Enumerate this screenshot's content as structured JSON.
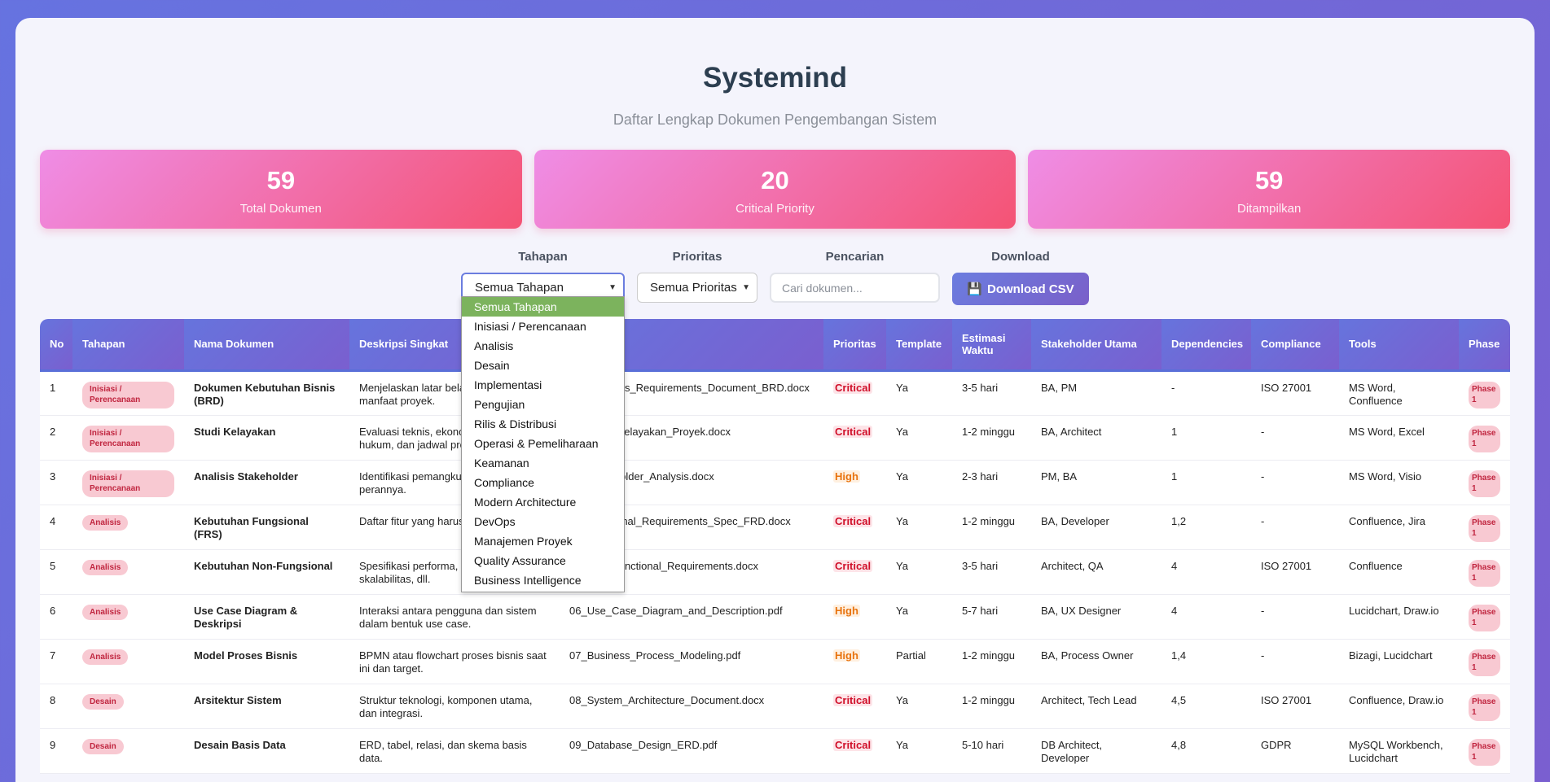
{
  "header": {
    "title": "Systemind",
    "subtitle": "Daftar Lengkap Dokumen Pengembangan Sistem"
  },
  "stats": [
    {
      "value": "59",
      "label": "Total Dokumen"
    },
    {
      "value": "20",
      "label": "Critical Priority"
    },
    {
      "value": "59",
      "label": "Ditampilkan"
    }
  ],
  "filters": {
    "stage_label": "Tahapan",
    "stage_value": "Semua Tahapan",
    "priority_label": "Prioritas",
    "priority_value": "Semua Prioritas",
    "search_label": "Pencarian",
    "search_placeholder": "Cari dokumen...",
    "download_label": "Download",
    "download_button": "Download CSV",
    "download_icon": "💾"
  },
  "stage_options": [
    "Semua Tahapan",
    "Inisiasi / Perencanaan",
    "Analisis",
    "Desain",
    "Implementasi",
    "Pengujian",
    "Rilis & Distribusi",
    "Operasi & Pemeliharaan",
    "Keamanan",
    "Compliance",
    "Modern Architecture",
    "DevOps",
    "Manajemen Proyek",
    "Quality Assurance",
    "Business Intelligence"
  ],
  "table": {
    "columns": [
      "No",
      "Tahapan",
      "Nama Dokumen",
      "Deskripsi Singkat",
      "Nama File",
      "Prioritas",
      "Template",
      "Estimasi Waktu",
      "Stakeholder Utama",
      "Dependencies",
      "Compliance",
      "Tools",
      "Phase"
    ],
    "rows": [
      {
        "no": "1",
        "stage": "Inisiasi / Perencanaan",
        "name": "Dokumen Kebutuhan Bisnis (BRD)",
        "desc": "Menjelaskan latar belakang, tujuan, dan manfaat proyek.",
        "file": "01_Business_Requirements_Document_BRD.docx",
        "priority": "Critical",
        "template": "Ya",
        "time": "3-5 hari",
        "stakeholder": "BA, PM",
        "deps": "-",
        "compliance": "ISO 27001",
        "tools": "MS Word, Confluence",
        "phase": "Phase 1"
      },
      {
        "no": "2",
        "stage": "Inisiasi / Perencanaan",
        "name": "Studi Kelayakan",
        "desc": "Evaluasi teknis, ekonomi, operasional, hukum, dan jadwal proyek.",
        "file": "02_Studi_Kelayakan_Proyek.docx",
        "priority": "Critical",
        "template": "Ya",
        "time": "1-2 minggu",
        "stakeholder": "BA, Architect",
        "deps": "1",
        "compliance": "-",
        "tools": "MS Word, Excel",
        "phase": "Phase 1"
      },
      {
        "no": "3",
        "stage": "Inisiasi / Perencanaan",
        "name": "Analisis Stakeholder",
        "desc": "Identifikasi pemangku kepentingan dan perannya.",
        "file": "03_Stakeholder_Analysis.docx",
        "priority": "High",
        "template": "Ya",
        "time": "2-3 hari",
        "stakeholder": "PM, BA",
        "deps": "1",
        "compliance": "-",
        "tools": "MS Word, Visio",
        "phase": "Phase 1"
      },
      {
        "no": "4",
        "stage": "Analisis",
        "name": "Kebutuhan Fungsional (FRS)",
        "desc": "Daftar fitur yang harus dimiliki sistem.",
        "file": "04_Functional_Requirements_Spec_FRD.docx",
        "priority": "Critical",
        "template": "Ya",
        "time": "1-2 minggu",
        "stakeholder": "BA, Developer",
        "deps": "1,2",
        "compliance": "-",
        "tools": "Confluence, Jira",
        "phase": "Phase 1"
      },
      {
        "no": "5",
        "stage": "Analisis",
        "name": "Kebutuhan Non-Fungsional",
        "desc": "Spesifikasi performa, keamanan, skalabilitas, dll.",
        "file": "05_Non_Functional_Requirements.docx",
        "priority": "Critical",
        "template": "Ya",
        "time": "3-5 hari",
        "stakeholder": "Architect, QA",
        "deps": "4",
        "compliance": "ISO 27001",
        "tools": "Confluence",
        "phase": "Phase 1"
      },
      {
        "no": "6",
        "stage": "Analisis",
        "name": "Use Case Diagram & Deskripsi",
        "desc": "Interaksi antara pengguna dan sistem dalam bentuk use case.",
        "file": "06_Use_Case_Diagram_and_Description.pdf",
        "priority": "High",
        "template": "Ya",
        "time": "5-7 hari",
        "stakeholder": "BA, UX Designer",
        "deps": "4",
        "compliance": "-",
        "tools": "Lucidchart, Draw.io",
        "phase": "Phase 1"
      },
      {
        "no": "7",
        "stage": "Analisis",
        "name": "Model Proses Bisnis",
        "desc": "BPMN atau flowchart proses bisnis saat ini dan target.",
        "file": "07_Business_Process_Modeling.pdf",
        "priority": "High",
        "template": "Partial",
        "time": "1-2 minggu",
        "stakeholder": "BA, Process Owner",
        "deps": "1,4",
        "compliance": "-",
        "tools": "Bizagi, Lucidchart",
        "phase": "Phase 1"
      },
      {
        "no": "8",
        "stage": "Desain",
        "name": "Arsitektur Sistem",
        "desc": "Struktur teknologi, komponen utama, dan integrasi.",
        "file": "08_System_Architecture_Document.docx",
        "priority": "Critical",
        "template": "Ya",
        "time": "1-2 minggu",
        "stakeholder": "Architect, Tech Lead",
        "deps": "4,5",
        "compliance": "ISO 27001",
        "tools": "Confluence, Draw.io",
        "phase": "Phase 1"
      },
      {
        "no": "9",
        "stage": "Desain",
        "name": "Desain Basis Data",
        "desc": "ERD, tabel, relasi, dan skema basis data.",
        "file": "09_Database_Design_ERD.pdf",
        "priority": "Critical",
        "template": "Ya",
        "time": "5-10 hari",
        "stakeholder": "DB Architect, Developer",
        "deps": "4,8",
        "compliance": "GDPR",
        "tools": "MySQL Workbench, Lucidchart",
        "phase": "Phase 1"
      }
    ]
  },
  "colors": {
    "accent": "#6b7ddf",
    "stat_gradient_start": "#ef8de6",
    "stat_gradient_end": "#f45374",
    "critical": "#d0102a",
    "high": "#e8730e",
    "dropdown_selected": "#7cb35d"
  }
}
